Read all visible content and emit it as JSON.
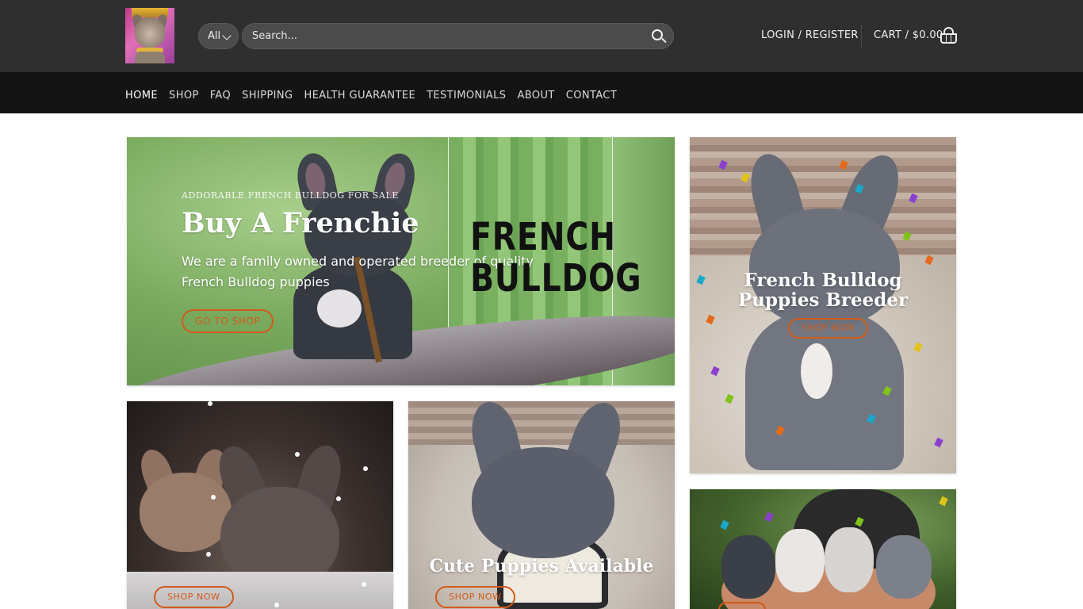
{
  "header": {
    "logo_alt": "French bulldog logo",
    "search": {
      "category_selected": "All",
      "placeholder": "Search..."
    },
    "login_label": "LOGIN / REGISTER",
    "cart_label": "CART / $0.00"
  },
  "nav": {
    "items": [
      {
        "label": "HOME",
        "active": true
      },
      {
        "label": "SHOP"
      },
      {
        "label": "FAQ"
      },
      {
        "label": "SHIPPING"
      },
      {
        "label": "HEALTH GUARANTEE"
      },
      {
        "label": "TESTIMONIALS"
      },
      {
        "label": "ABOUT"
      },
      {
        "label": "CONTACT"
      }
    ]
  },
  "hero": {
    "eyebrow": "ADDORABLE FRENCH BULLDOG FOR SALE",
    "title": "Buy A Frenchie",
    "description": "We are a family owned and operated breeder of quality French Bulldog  puppies",
    "button_label": "GO TO SHOP",
    "brand_line1": "FRENCH",
    "brand_line2": "BULLDOG"
  },
  "tiles": {
    "breeder": {
      "caption_line1": "French Bulldog",
      "caption_line2": "Puppies Breeder",
      "button_label": "SHOP NOW"
    },
    "pair": {
      "button_label": "SHOP NOW"
    },
    "cute": {
      "caption": "Cute Puppies Available",
      "button_label": "SHOP NOW"
    },
    "litter": {
      "button_label": ""
    }
  },
  "colors": {
    "header_bg": "#2f2f2f",
    "nav_bg": "#141414",
    "accent": "#d35a1a"
  },
  "icons": {
    "search": "search-icon",
    "cart": "cart-basket-icon",
    "chevron": "chevron-down-icon"
  }
}
